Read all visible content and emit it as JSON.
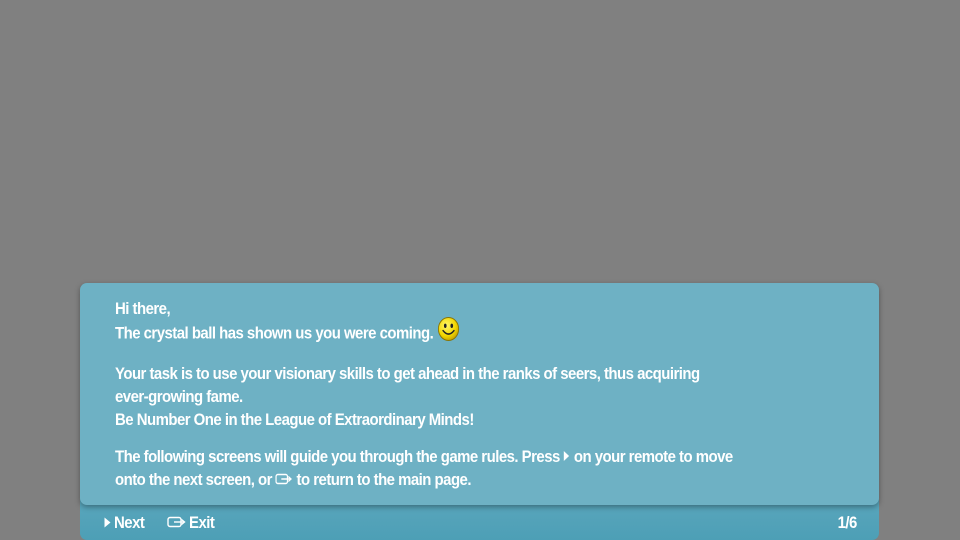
{
  "dialog": {
    "greeting": "Hi there,",
    "crystal_line": "The crystal ball  has shown us you were coming.",
    "task_line1": "Your task is to use your visionary skills to get ahead in the ranks of seers, thus acquiring",
    "task_line2": "ever-growing fame.",
    "task_line3": "Be Number One in the League of Extraordinary Minds!",
    "guide_line1_a": "The following screens will guide you through the game rules. Press",
    "guide_line1_b": "on your remote to move",
    "guide_line2_a": "onto the next screen, or",
    "guide_line2_b": "to return to the main page."
  },
  "footer": {
    "next_label": "Next",
    "exit_label": "Exit",
    "page_indicator": "1/6"
  },
  "icons": {
    "smiley": "smiley-face-icon",
    "next": "play-arrow-icon",
    "exit": "exit-icon"
  },
  "colors": {
    "background": "#808080",
    "dialog": "#6eb1c4",
    "footer": "#4d9fb6",
    "text": "#ffffff"
  }
}
